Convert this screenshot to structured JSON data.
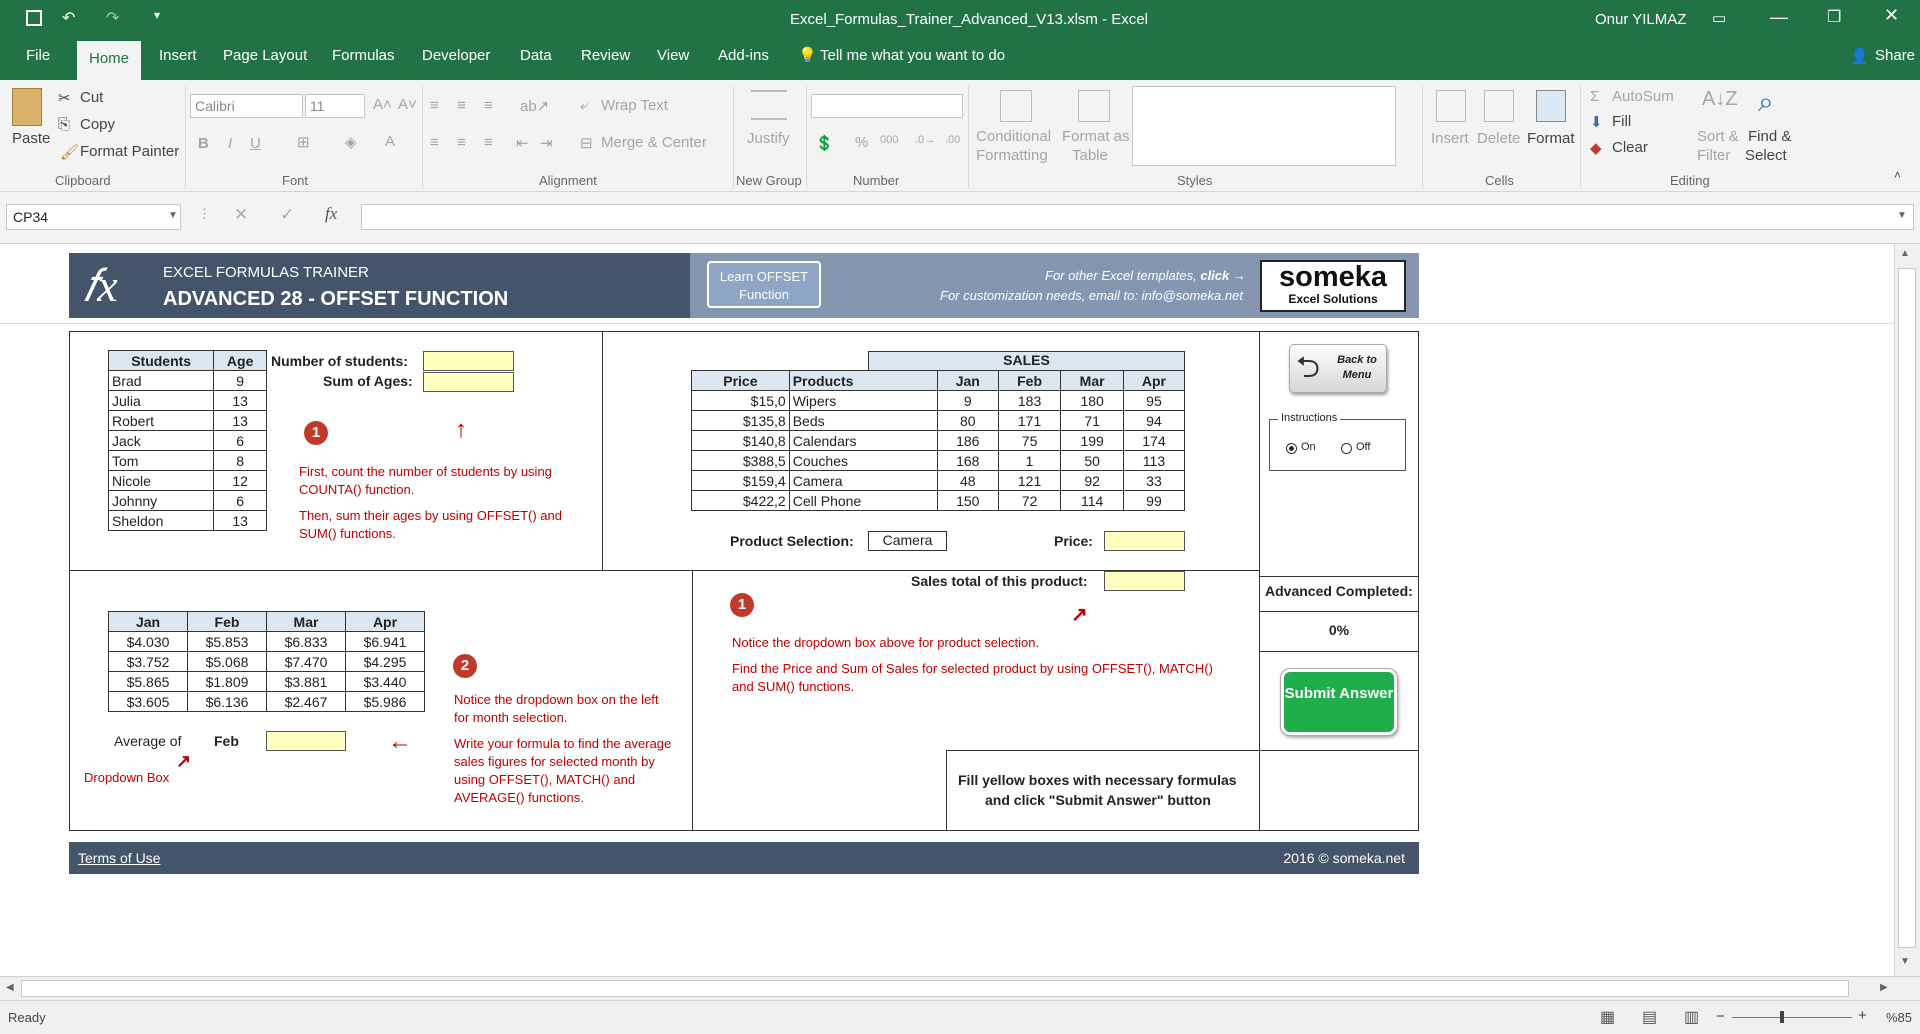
{
  "window": {
    "title": "Excel_Formulas_Trainer_Advanced_V13.xlsm - Excel",
    "user": "Onur YILMAZ"
  },
  "tabs": [
    "File",
    "Home",
    "Insert",
    "Page Layout",
    "Formulas",
    "Developer",
    "Data",
    "Review",
    "View",
    "Add-ins"
  ],
  "tell_me": "Tell me what you want to do",
  "share": "Share",
  "ribbon": {
    "paste": "Paste",
    "cut": "Cut",
    "copy": "Copy",
    "format_painter": "Format Painter",
    "clipboard": "Clipboard",
    "font_name": "Calibri",
    "font_size": "11",
    "font": "Font",
    "bold": "B",
    "italic": "I",
    "underline": "U",
    "wrap_text": "Wrap Text",
    "merge_center": "Merge & Center",
    "alignment": "Alignment",
    "justify": "Justify",
    "new_group": "New Group",
    "percent": "%",
    "number": "Number",
    "conditional": "Conditional",
    "formatting": "Formatting",
    "format_as": "Format as",
    "table": "Table",
    "styles": "Styles",
    "insert": "Insert",
    "delete": "Delete",
    "format": "Format",
    "cells": "Cells",
    "autosum": "AutoSum",
    "fill": "Fill",
    "clear": "Clear",
    "sort": "Sort &",
    "filter": "Filter",
    "find": "Find &",
    "select": "Select",
    "editing": "Editing"
  },
  "name_box": "CP34",
  "fx": "fx",
  "header": {
    "subtitle": "EXCEL FORMULAS TRAINER",
    "title": "ADVANCED 28 - OFFSET FUNCTION",
    "learn_btn": "Learn OFFSET Function",
    "other_prefix": "For other Excel templates, ",
    "other_click": "click →",
    "custom": "For customization needs, email to: info@someka.net",
    "logo": "someka",
    "logo_sub": "Excel Solutions"
  },
  "students": {
    "headers": [
      "Students",
      "Age"
    ],
    "rows": [
      [
        "Brad",
        "9"
      ],
      [
        "Julia",
        "13"
      ],
      [
        "Robert",
        "13"
      ],
      [
        "Jack",
        "6"
      ],
      [
        "Tom",
        "8"
      ],
      [
        "Nicole",
        "12"
      ],
      [
        "Johnny",
        "6"
      ],
      [
        "Sheldon",
        "13"
      ]
    ],
    "num_label": "Number of students:",
    "sum_label": "Sum of Ages:",
    "badge": "1",
    "hint1": "First, count the number of students by using COUNTA() function.",
    "hint2": "Then, sum their ages by using OFFSET() and SUM() functions."
  },
  "months": {
    "headers": [
      "Jan",
      "Feb",
      "Mar",
      "Apr"
    ],
    "rows": [
      [
        "$4.030",
        "$5.853",
        "$6.833",
        "$6.941"
      ],
      [
        "$3.752",
        "$5.068",
        "$7.470",
        "$4.295"
      ],
      [
        "$5.865",
        "$1.809",
        "$3.881",
        "$3.440"
      ],
      [
        "$3.605",
        "$6.136",
        "$2.467",
        "$5.986"
      ]
    ],
    "avg_label": "Average of",
    "avg_month": "Feb",
    "dropdown": "Dropdown Box",
    "badge": "2",
    "hint1": "Notice the dropdown box on the left for month selection.",
    "hint2": "Write your formula to find the average sales figures for selected month by using OFFSET(), MATCH() and AVERAGE() functions."
  },
  "sales": {
    "caption": "SALES",
    "headers": [
      "Price",
      "Products",
      "Jan",
      "Feb",
      "Mar",
      "Apr"
    ],
    "rows": [
      [
        "$15,0",
        "Wipers",
        "9",
        "183",
        "180",
        "95"
      ],
      [
        "$135,8",
        "Beds",
        "80",
        "171",
        "71",
        "94"
      ],
      [
        "$140,8",
        "Calendars",
        "186",
        "75",
        "199",
        "174"
      ],
      [
        "$388,5",
        "Couches",
        "168",
        "1",
        "50",
        "113"
      ],
      [
        "$159,4",
        "Camera",
        "48",
        "121",
        "92",
        "33"
      ],
      [
        "$422,2",
        "Cell Phone",
        "150",
        "72",
        "114",
        "99"
      ]
    ],
    "product_label": "Product Selection:",
    "product_value": "Camera",
    "price_label": "Price:",
    "total_label": "Sales total of this product:",
    "badge": "1",
    "hint1": "Notice the dropdown box above for product selection.",
    "hint2": "Find the Price and Sum of Sales for selected product by using OFFSET(), MATCH() and SUM() functions."
  },
  "side": {
    "back": "Back to Menu",
    "instructions": "Instructions",
    "on": "On",
    "off": "Off",
    "completed_label": "Advanced Completed:",
    "completed_value": "0%",
    "submit": "Submit Answer"
  },
  "fill_note1": "Fill yellow boxes with necessary formulas",
  "fill_note2": "and click \"Submit Answer\" button",
  "footer": {
    "terms": "Terms of Use",
    "copyright": "2016 © someka.net"
  },
  "status": {
    "ready": "Ready",
    "zoom": "%85"
  }
}
